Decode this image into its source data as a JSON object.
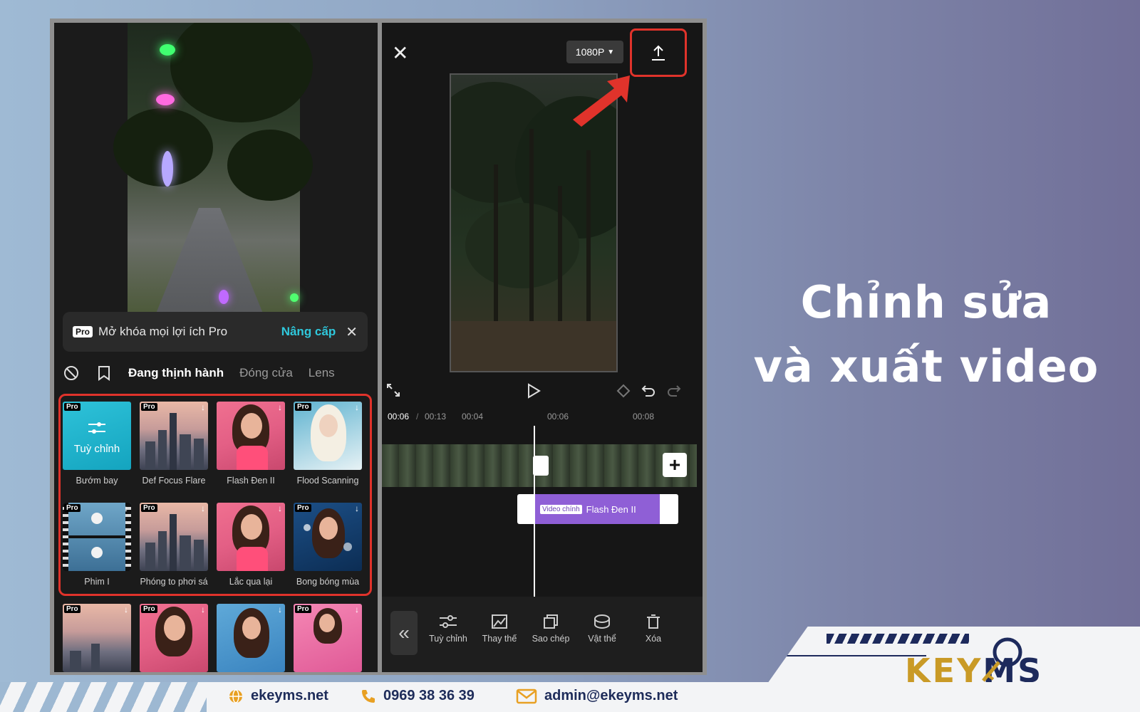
{
  "headline": {
    "line1": "Chỉnh sửa",
    "line2": "và xuất video"
  },
  "left_panel": {
    "pro_banner": {
      "badge": "Pro",
      "text": "Mở khóa mọi lợi ích Pro",
      "upgrade": "Nâng cấp"
    },
    "tabs": [
      {
        "label": "Đang thịnh hành",
        "active": true
      },
      {
        "label": "Đóng cửa",
        "active": false
      },
      {
        "label": "Lens",
        "active": false
      }
    ],
    "effects": [
      {
        "label": "Bướm bay",
        "pro": true,
        "thumb_text": "Tuỳ chỉnh"
      },
      {
        "label": "Def Focus Flare",
        "pro": true
      },
      {
        "label": "Flash Đen II",
        "pro": false
      },
      {
        "label": "Flood Scanning",
        "pro": true
      },
      {
        "label": "Phim I",
        "pro": true
      },
      {
        "label": "Phóng to phơi sá",
        "pro": true
      },
      {
        "label": "Lắc qua lại",
        "pro": false
      },
      {
        "label": "Bong bóng mùa",
        "pro": true
      }
    ],
    "pro_badge": "Pro"
  },
  "right_panel": {
    "resolution": "1080P",
    "time_current": "00:06",
    "time_sep": "/",
    "time_total": "00:13",
    "ruler": [
      "00:04",
      "00:06",
      "00:08"
    ],
    "clip": {
      "tag": "Video chính",
      "name": "Flash Đen II"
    },
    "tools": [
      "Tuỳ chỉnh",
      "Thay thế",
      "Sao chép",
      "Vật thể",
      "Xóa"
    ]
  },
  "footer": {
    "website": "ekeyms.net",
    "phone": "0969 38 36 39",
    "email": "admin@ekeyms.net"
  },
  "logo": {
    "part1": "KEY",
    "part2": "MS"
  },
  "colors": {
    "highlight": "#e0332b",
    "accent": "#2fc8dc",
    "clip": "#8f5fd6",
    "brand_gold": "#c99a26",
    "brand_navy": "#1d2a5c"
  }
}
